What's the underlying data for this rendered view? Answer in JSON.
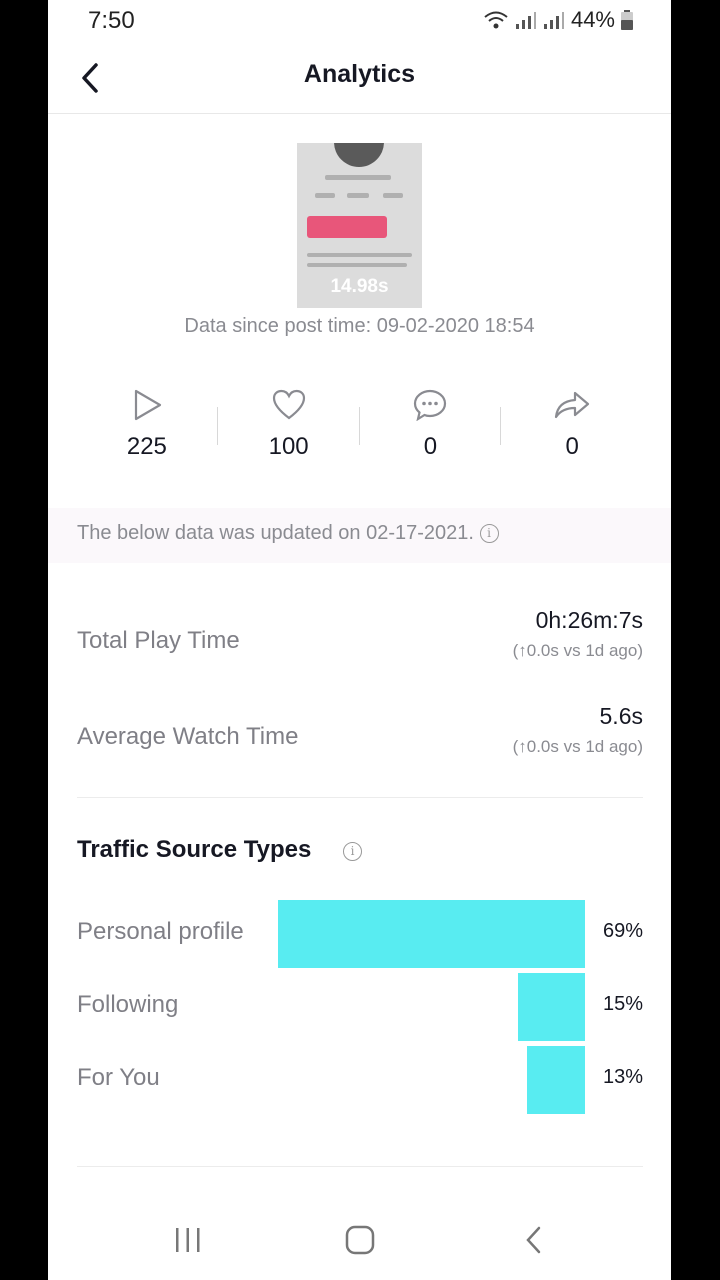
{
  "status_bar": {
    "time": "7:50",
    "battery": "44%"
  },
  "header": {
    "title": "Analytics"
  },
  "video": {
    "duration": "14.98s",
    "post_time": "Data since post time: 09-02-2020 18:54"
  },
  "stats": [
    {
      "icon": "play-icon",
      "value": "225"
    },
    {
      "icon": "heart-icon",
      "value": "100"
    },
    {
      "icon": "comment-icon",
      "value": "0"
    },
    {
      "icon": "share-icon",
      "value": "0"
    }
  ],
  "update_notice": "The below data was updated on 02-17-2021.",
  "metrics": [
    {
      "label": "Total Play Time",
      "value": "0h:26m:7s",
      "delta": "(↑0.0s vs 1d ago)"
    },
    {
      "label": "Average Watch Time",
      "value": "5.6s",
      "delta": "(↑0.0s vs 1d ago)"
    }
  ],
  "traffic": {
    "title": "Traffic Source Types",
    "bar_color": "#58ecf1",
    "items": [
      {
        "label": "Personal profile",
        "percent": 69,
        "display": "69%"
      },
      {
        "label": "Following",
        "percent": 15,
        "display": "15%"
      },
      {
        "label": "For You",
        "percent": 13,
        "display": "13%"
      }
    ]
  }
}
